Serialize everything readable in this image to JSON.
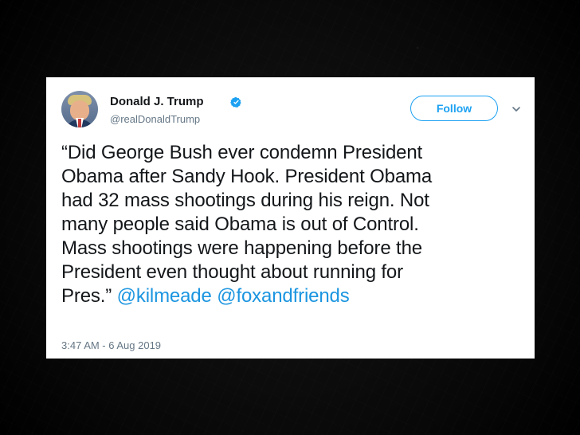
{
  "tweet": {
    "author_name": "Donald J. Trump",
    "author_handle": "@realDonaldTrump",
    "follow_label": "Follow",
    "text_lines": [
      "“Did George Bush ever condemn President",
      "Obama after Sandy Hook. President Obama",
      "had 32 mass shootings during his reign. Not",
      "many people said Obama is out of Control.",
      "Mass shootings were happening before the",
      "President even thought about running for",
      "Pres.”"
    ],
    "mentions": [
      "@kilmeade",
      "@foxandfriends"
    ],
    "timestamp": "3:47 AM - 6 Aug 2019"
  },
  "icons": {
    "avatar": "profile-avatar",
    "verified": "verified-badge-icon",
    "menu": "chevron-down-icon"
  },
  "colors": {
    "accent": "#1da1f2",
    "mention": "#1b95e0",
    "muted": "#657786"
  }
}
